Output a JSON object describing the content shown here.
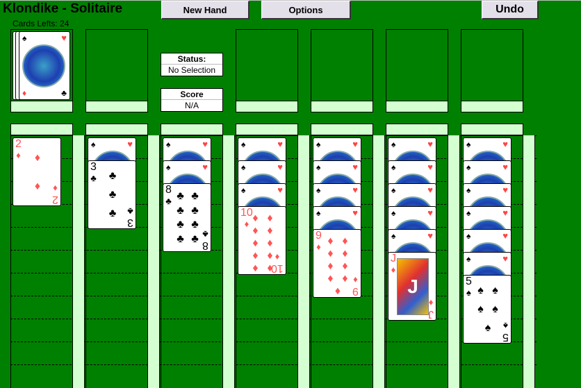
{
  "title": "Klondike - Solitaire",
  "cards_left": "Cards Lefts: 24",
  "buttons": {
    "new_hand": "New Hand",
    "options": "Options",
    "undo": "Undo"
  },
  "status": {
    "label": "Status:",
    "value": "No Selection"
  },
  "score": {
    "label": "Score",
    "value": "N/A"
  },
  "colors": {
    "table": "#008000",
    "strip": "#d4ffd0",
    "red_suit": "#ff5555"
  },
  "back_corners": [
    "♠",
    "♥",
    "♦",
    "♣"
  ],
  "tableau": [
    {
      "hidden": 0,
      "face": {
        "rank": "2",
        "suit": "♦"
      }
    },
    {
      "hidden": 1,
      "face": {
        "rank": "3",
        "suit": "♣"
      }
    },
    {
      "hidden": 2,
      "face": {
        "rank": "8",
        "suit": "♣"
      }
    },
    {
      "hidden": 3,
      "face": {
        "rank": "10",
        "suit": "♦"
      }
    },
    {
      "hidden": 4,
      "face": {
        "rank": "9",
        "suit": "♦"
      }
    },
    {
      "hidden": 5,
      "face": {
        "rank": "J",
        "suit": "♦"
      }
    },
    {
      "hidden": 6,
      "face": {
        "rank": "5",
        "suit": "♠"
      }
    }
  ]
}
